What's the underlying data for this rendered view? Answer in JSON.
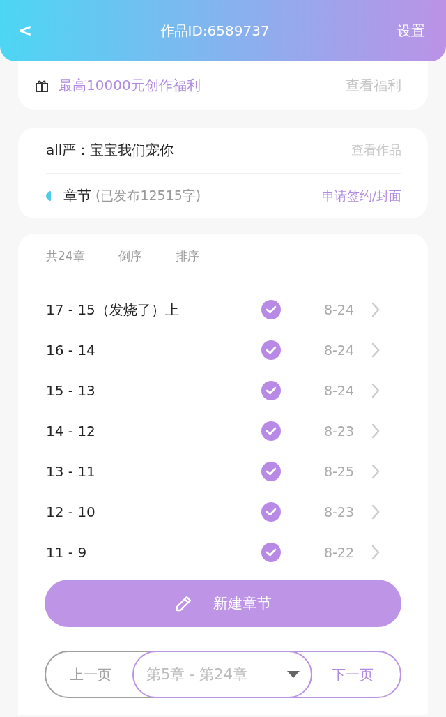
{
  "header": {
    "back": "<",
    "title": "作品ID:6589737",
    "action": "设置"
  },
  "welfare": {
    "text": "最高10000元创作福利",
    "link": "查看福利"
  },
  "work": {
    "title": "all严：宝宝我们宠你",
    "link": "查看作品",
    "section": "章节",
    "count": "(已发布12515字)",
    "apply": "申请签约/封面"
  },
  "toolbar": {
    "total": "共24章",
    "reverse": "倒序",
    "sort": "排序"
  },
  "chapters": [
    {
      "title": "17 - 15（发烧了）上",
      "published": true,
      "date": "8-24"
    },
    {
      "title": "16 - 14",
      "published": true,
      "date": "8-24"
    },
    {
      "title": "15 -  13",
      "published": true,
      "date": "8-24"
    },
    {
      "title": "14 - 12",
      "published": true,
      "date": "8-23"
    },
    {
      "title": "13 - 11",
      "published": true,
      "date": "8-25"
    },
    {
      "title": "12 - 10",
      "published": true,
      "date": "8-23"
    },
    {
      "title": "11 - 9",
      "published": true,
      "date": "8-22"
    }
  ],
  "new_button": "新建章节",
  "pager": {
    "prev": {
      "label": "上一页",
      "disabled": true
    },
    "range": "第5章 - 第24章",
    "next": {
      "label": "下一页",
      "disabled": false
    }
  }
}
